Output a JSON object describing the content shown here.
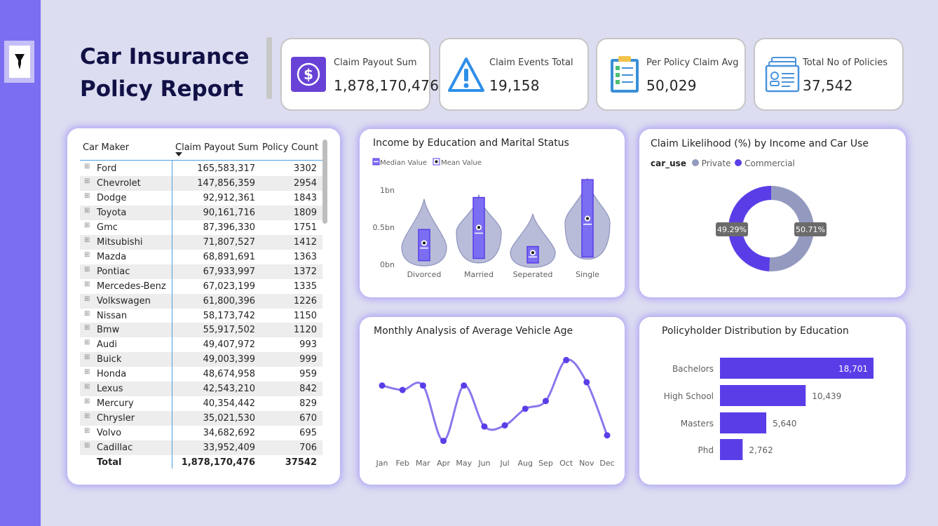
{
  "header": {
    "title_line1": "Car Insurance",
    "title_line2": "Policy Report"
  },
  "sidebar": {
    "filter_icon": "filter-icon"
  },
  "kpis": [
    {
      "label": "Claim Payout Sum",
      "value": "1,878,170,476",
      "icon": "dollar-icon"
    },
    {
      "label": "Claim Events Total",
      "value": "19,158",
      "icon": "warning-icon"
    },
    {
      "label": "Per Policy Claim Avg",
      "value": "50,029",
      "icon": "clipboard-icon"
    },
    {
      "label": "Total No of Policies",
      "value": "37,542",
      "icon": "documents-icon"
    }
  ],
  "table": {
    "headers": [
      "Car Maker",
      "Claim Payout Sum",
      "Policy Count"
    ],
    "rows": [
      [
        "Ford",
        "165,583,317",
        "3302"
      ],
      [
        "Chevrolet",
        "147,856,359",
        "2954"
      ],
      [
        "Dodge",
        "92,912,361",
        "1843"
      ],
      [
        "Toyota",
        "90,161,716",
        "1809"
      ],
      [
        "Gmc",
        "87,396,330",
        "1751"
      ],
      [
        "Mitsubishi",
        "71,807,527",
        "1412"
      ],
      [
        "Mazda",
        "68,891,691",
        "1363"
      ],
      [
        "Pontiac",
        "67,933,997",
        "1372"
      ],
      [
        "Mercedes-Benz",
        "67,023,199",
        "1335"
      ],
      [
        "Volkswagen",
        "61,800,396",
        "1226"
      ],
      [
        "Nissan",
        "58,173,742",
        "1150"
      ],
      [
        "Bmw",
        "55,917,502",
        "1120"
      ],
      [
        "Audi",
        "49,407,972",
        "993"
      ],
      [
        "Buick",
        "49,003,399",
        "999"
      ],
      [
        "Honda",
        "48,674,958",
        "959"
      ],
      [
        "Lexus",
        "42,543,210",
        "842"
      ],
      [
        "Mercury",
        "40,354,442",
        "829"
      ],
      [
        "Chrysler",
        "35,021,530",
        "670"
      ],
      [
        "Volvo",
        "34,682,692",
        "695"
      ],
      [
        "Cadillac",
        "33,952,409",
        "706"
      ]
    ],
    "total": [
      "Total",
      "1,878,170,476",
      "37542"
    ]
  },
  "colors": {
    "accent": "#7b6ef2",
    "purple": "#5b3de8",
    "dark_purple": "#4e2bd9",
    "grey_series": "#949abf",
    "navy": "#111146"
  },
  "chart_data": [
    {
      "type": "violin",
      "title": "Income by Education and Marital Status",
      "legend": [
        "Median Value",
        "Mean Value"
      ],
      "y_tick_labels": [
        "1bn",
        "0.5bn",
        "0bn"
      ],
      "ylim": [
        0,
        1
      ],
      "categories": [
        "Divorced",
        "Married",
        "Seperated",
        "Single"
      ],
      "box_low": [
        0.05,
        0.08,
        0.02,
        0.1
      ],
      "box_high": [
        0.47,
        0.9,
        0.24,
        1.14
      ],
      "median": [
        0.22,
        0.42,
        0.1,
        0.54
      ],
      "mean": [
        0.25,
        0.46,
        0.12,
        0.58
      ],
      "violin_min": [
        -0.02,
        0.02,
        -0.04,
        0.07
      ],
      "violin_max": [
        0.88,
        0.94,
        0.68,
        1.16
      ]
    },
    {
      "type": "pie",
      "title": "Claim Likelihood (%) by Income and Car Use",
      "legend_title": "car_use",
      "labels": [
        "Private",
        "Commercial"
      ],
      "values": [
        50.71,
        49.29
      ],
      "value_labels": [
        "50.71%",
        "49.29%"
      ],
      "colors": [
        "#949abf",
        "#5b3de8"
      ],
      "donut": true
    },
    {
      "type": "line",
      "title": "Monthly Analysis of Average Vehicle Age",
      "categories": [
        "Jan",
        "Feb",
        "Mar",
        "Apr",
        "May",
        "Jun",
        "Jul",
        "Aug",
        "Sep",
        "Oct",
        "Nov",
        "Dec"
      ],
      "values": [
        0.72,
        0.64,
        0.72,
        -0.28,
        0.72,
        -0.02,
        0.0,
        0.3,
        0.44,
        1.18,
        0.78,
        -0.18
      ],
      "ylim": [
        -0.45,
        1.35
      ],
      "smooth": true
    },
    {
      "type": "bar",
      "orientation": "horizontal",
      "title": "Policyholder Distribution by Education",
      "categories": [
        "Bachelors",
        "High School",
        "Masters",
        "Phd"
      ],
      "values": [
        18701,
        10439,
        5640,
        2762
      ],
      "value_labels": [
        "18,701",
        "10,439",
        "5,640",
        "2,762"
      ],
      "xlim": [
        0,
        18701
      ]
    }
  ]
}
